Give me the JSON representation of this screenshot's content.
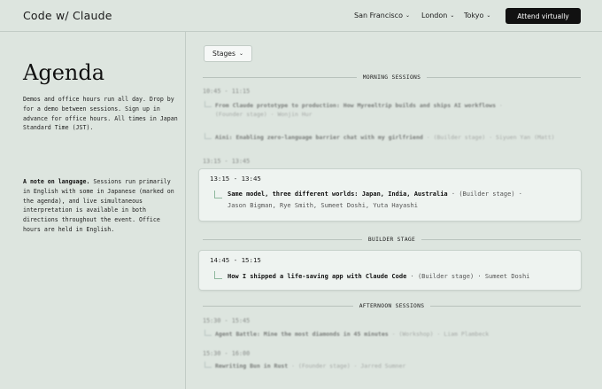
{
  "header": {
    "logo": "Code w/ Claude",
    "cities": [
      "San Francisco",
      "London",
      "Tokyo"
    ],
    "cta": "Attend virtually"
  },
  "sidebar": {
    "title": "Agenda",
    "intro": "Demos and office hours run all day. Drop by for a demo between sessions. Sign up in advance for office hours. All times in Japan Standard Time (JST).",
    "note_label": "A note on language.",
    "note_text": " Sessions run primarily in English with some in Japanese (marked on the agenda), and live simultaneous interpretation is available in both directions throughout the event. Office hours are held in English."
  },
  "filter": {
    "label": "Stages"
  },
  "sections": {
    "morning": "MORNING SESSIONS",
    "builder": "BUILDER STAGE",
    "afternoon": "AFTERNOON SESSIONS"
  },
  "morning": {
    "time1": "10:45 - 11:15",
    "talk1_title": "From Claude prototype to production: How Myreeltrip builds and ships AI workflows",
    "talk1_meta": "(Founder stage) · Wonjin Hur",
    "talk2_title": "Aini: Enabling zero-language barrier chat with my girlfriend",
    "talk2_meta": "(Builder stage) · Siyuen Yan (Matt)",
    "time2": "13:15 - 13:45"
  },
  "card1": {
    "time": "13:15 - 13:45",
    "title": "Same model, three different worlds: Japan, India, Australia",
    "stage": "(Builder stage) ·",
    "speakers": "Jason Bigman, Rye Smith, Sumeet Doshi, Yuta Hayashi"
  },
  "card2": {
    "time": "14:45 - 15:15",
    "title": "How I shipped a life-saving app with Claude Code",
    "stage": "(Builder stage)",
    "speaker": "Sumeet Doshi"
  },
  "afternoon": {
    "time1": "15:30 - 15:45",
    "talk1_title": "Agent Battle: Mine the most diamonds in 45 minutes",
    "talk1_meta": "(Workshop) · Liam Plambeck",
    "time2": "15:30 - 16:00",
    "talk2_title": "Rewriting Bun in Rust",
    "talk2_meta": "(Founder stage) · Jarred Sumner"
  }
}
